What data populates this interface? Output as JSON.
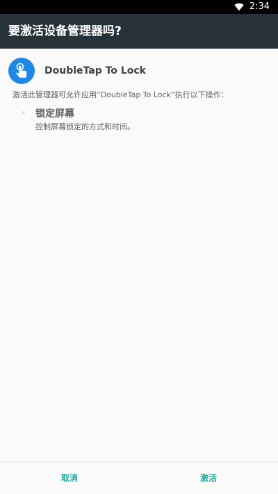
{
  "status_bar": {
    "time": "2:34",
    "wifi_icon": "wifi-icon"
  },
  "dialog": {
    "title": "要激活设备管理器吗?"
  },
  "app": {
    "icon": "tap-icon",
    "name": "DoubleTap To Lock"
  },
  "description": "激活此管理器可允许应用“DoubleTap To Lock”执行以下操作：",
  "policy": {
    "title": "锁定屏幕",
    "description": "控制屏幕锁定的方式和时间。"
  },
  "buttons": {
    "cancel": "取消",
    "activate": "激活"
  },
  "colors": {
    "title_bar": "#263238",
    "accent": "#26a69a",
    "app_icon": "#1e88e5"
  }
}
